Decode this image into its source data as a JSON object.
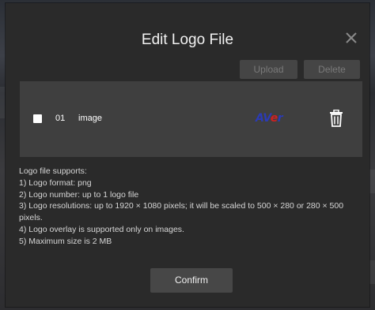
{
  "dialog": {
    "title": "Edit Logo File",
    "upload_label": "Upload",
    "delete_label": "Delete",
    "confirm_label": "Confirm"
  },
  "file_list": {
    "items": [
      {
        "number": "01",
        "name": "image",
        "checked": false,
        "logo_text": "AVer",
        "thumbnail_icon": "aver-logo",
        "delete_icon": "trash-icon"
      }
    ]
  },
  "info": {
    "heading": "Logo file supports:",
    "lines": [
      "1) Logo format: png",
      "2) Logo number: up to 1 logo file",
      "3) Logo resolutions: up to 1920 × 1080 pixels; it will be scaled to 500 × 280 or 280 × 500 pixels.",
      "4) Logo overlay is supported only on images.",
      "5) Maximum size is 2 MB"
    ]
  },
  "colors": {
    "modal_background": "#2a2a2a",
    "list_background": "#3f3f3f",
    "button_disabled": "#454545",
    "logo_blue": "#2b3bb5",
    "logo_red": "#d02020"
  }
}
